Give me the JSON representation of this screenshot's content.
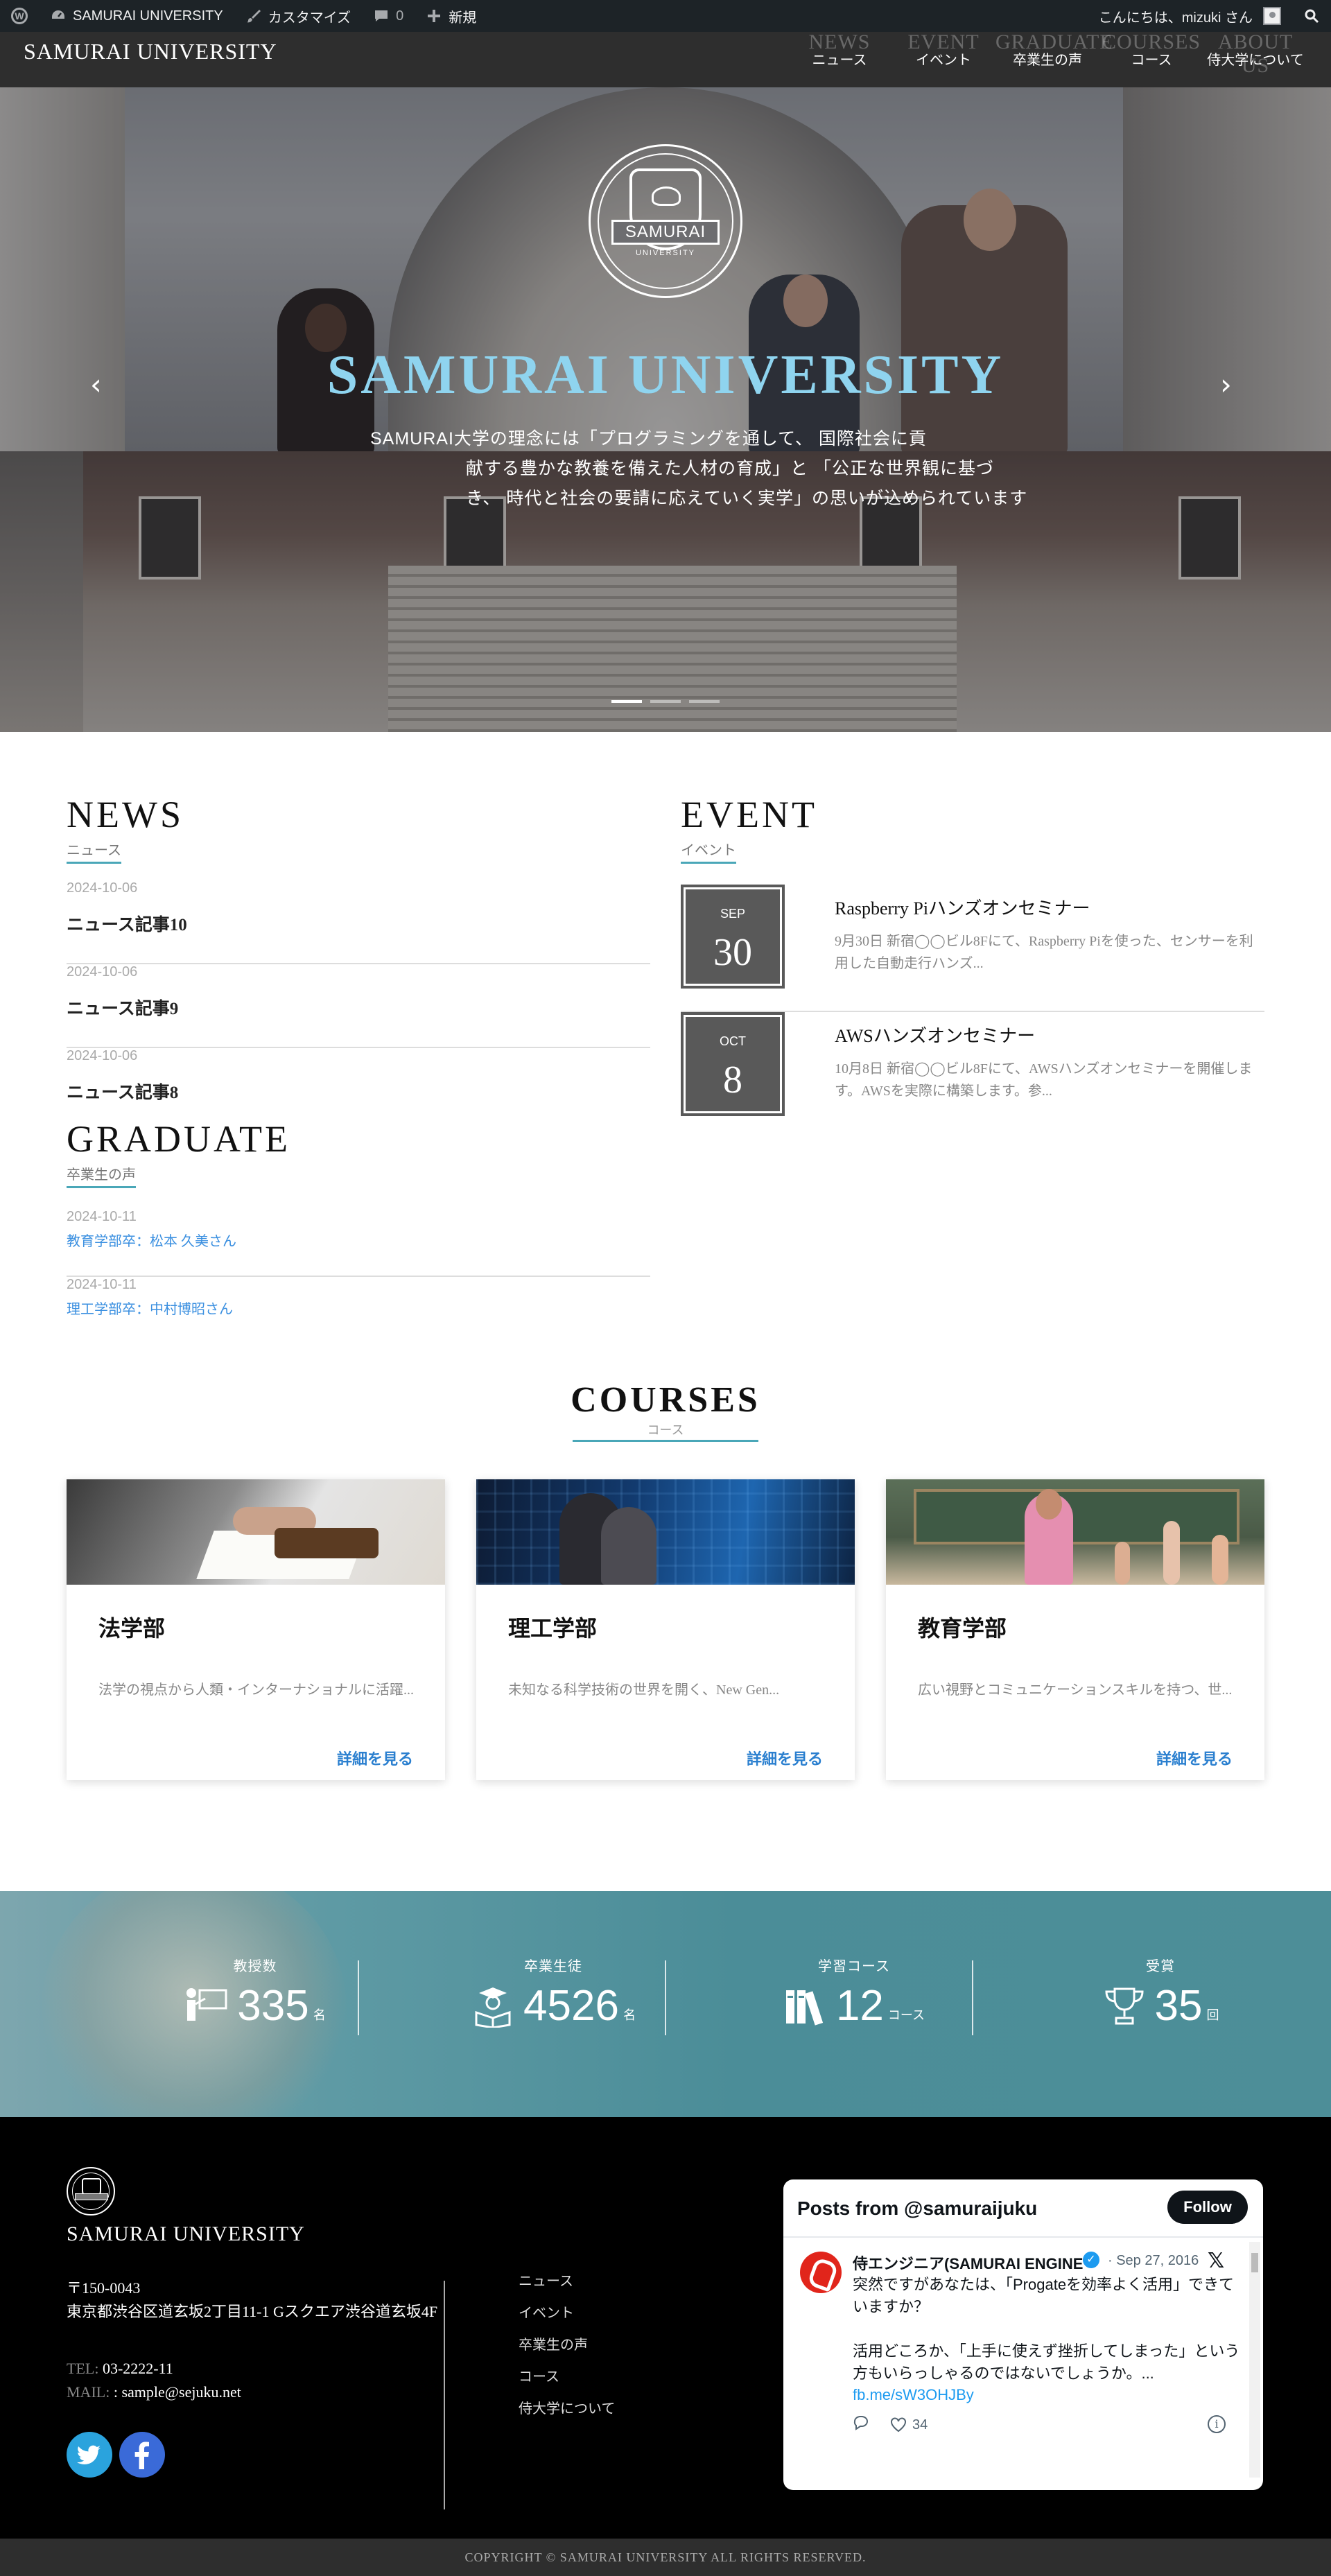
{
  "admin_bar": {
    "site_name": "SAMURAI UNIVERSITY",
    "customize": "カスタマイズ",
    "comments_count": "0",
    "new_label": "新規",
    "greeting": "こんにちは、mizuki さん"
  },
  "header": {
    "site_title": "SAMURAI UNIVERSITY",
    "nav": [
      {
        "en": "NEWS",
        "ja": "ニュース"
      },
      {
        "en": "EVENT",
        "ja": "イベント"
      },
      {
        "en": "GRADUATE",
        "ja": "卒業生の声"
      },
      {
        "en": "COURSES",
        "ja": "コース"
      },
      {
        "en": "ABOUT US",
        "ja": "侍大学について"
      }
    ]
  },
  "hero": {
    "emblem_text": "SAMURAI",
    "emblem_sub": "UNIVERSITY",
    "title": "SAMURAI UNIVERSITY",
    "text_line1": "SAMURAI大学の理念には「プログラミングを通して、 国際社会に貢",
    "text_rest": "献する豊かな教養を備えた人材の育成」と 「公正な世界観に基づき、 時代と社会の要請に応えていく実学」の思いが込められています",
    "prev_arrow": "‹",
    "next_arrow": "›",
    "slides": 3,
    "active_slide": 1
  },
  "news": {
    "title_en": "NEWS",
    "title_ja": "ニュース",
    "items": [
      {
        "date": "2024-10-06",
        "title": "ニュース記事10"
      },
      {
        "date": "2024-10-06",
        "title": "ニュース記事9"
      },
      {
        "date": "2024-10-06",
        "title": "ニュース記事8"
      }
    ]
  },
  "event": {
    "title_en": "EVENT",
    "title_ja": "イベント",
    "items": [
      {
        "month": "SEP",
        "day": "30",
        "title": "Raspberry Piハンズオンセミナー",
        "desc": "9月30日 新宿◯◯ビル8Fにて、Raspberry Piを使った、センサーを利用した自動走行ハンズ..."
      },
      {
        "month": "OCT",
        "day": "8",
        "title": "AWSハンズオンセミナー",
        "desc": "10月8日 新宿◯◯ビル8Fにて、AWSハンズオンセミナーを開催します。AWSを実際に構築します。参..."
      }
    ]
  },
  "graduate": {
    "title_en": "GRADUATE",
    "title_ja": "卒業生の声",
    "items": [
      {
        "date": "2024-10-11",
        "title": "教育学部卒：松本 久美さん"
      },
      {
        "date": "2024-10-11",
        "title": "理工学部卒：中村博昭さん"
      }
    ]
  },
  "courses": {
    "title_en": "COURSES",
    "title_ja": "コース",
    "items": [
      {
        "name": "法学部",
        "desc": "法学の視点から人類・インターナショナルに活躍...",
        "link": "詳細を見る"
      },
      {
        "name": "理工学部",
        "desc": "未知なる科学技術の世界を開く、New Gen...",
        "link": "詳細を見る"
      },
      {
        "name": "教育学部",
        "desc": "広い視野とコミュニケーションスキルを持つ、世...",
        "link": "詳細を見る"
      }
    ]
  },
  "stats": [
    {
      "label": "教授数",
      "number": "335",
      "unit": "名",
      "icon": "teacher-icon"
    },
    {
      "label": "卒業生徒",
      "number": "4526",
      "unit": "名",
      "icon": "graduate-reading-icon"
    },
    {
      "label": "学習コース",
      "number": "12",
      "unit": "コース",
      "icon": "books-icon"
    },
    {
      "label": "受賞",
      "number": "35",
      "unit": "回",
      "icon": "trophy-icon"
    }
  ],
  "footer": {
    "name": "SAMURAI UNIVERSITY",
    "address": "〒150-0043\n東京都渋谷区道玄坂2丁目11-1 Gスクエア渋谷道玄坂4F",
    "tel_label": "TEL:",
    "tel": "03-2222-11",
    "mail_label": "MAIL:",
    "mail": ": sample@sejuku.net",
    "menu": [
      "ニュース",
      "イベント",
      "卒業生の声",
      "コース",
      "侍大学について"
    ],
    "copyright": "COPYRIGHT © SAMURAI UNIVERSITY ALL RIGHTS RESERVED."
  },
  "twitter": {
    "header": "Posts from @samuraijuku",
    "follow": "Follow",
    "name": "侍エンジニア(SAMURAI ENGINE",
    "date": "· Sep 27, 2016",
    "text1": "突然ですがあなたは、「Progateを効率よく活用」できていますか？",
    "text2": "活用どころか、「上手に使えず挫折してしまった」という方もいらっしゃるのではないでしょうか。...",
    "link": "fb.me/sW3OHJBy",
    "likes": "34"
  },
  "colors": {
    "accent": "#4aa7b8",
    "link": "#2a7fcf",
    "hero_title": "#8fd4ef",
    "admin_bar": "#1d2327"
  }
}
